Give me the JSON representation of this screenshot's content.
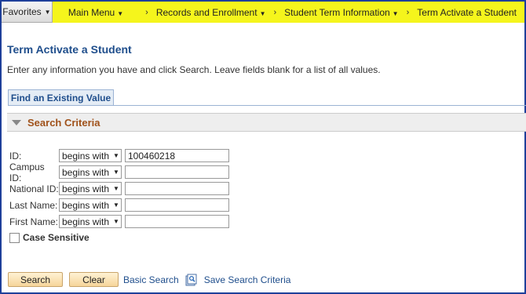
{
  "topnav": {
    "favorites": "Favorites",
    "breadcrumbs": [
      "Main Menu",
      "Records and Enrollment",
      "Student Term Information",
      "Term Activate a Student"
    ]
  },
  "page": {
    "title": "Term Activate a Student",
    "instructions": "Enter any information you have and click Search. Leave fields blank for a list of all values."
  },
  "tab": {
    "label": "Find an Existing Value"
  },
  "section": {
    "label": "Search Criteria"
  },
  "fields": [
    {
      "label": "ID:",
      "operator": "begins with",
      "value": "100460218"
    },
    {
      "label": "Campus ID:",
      "operator": "begins with",
      "value": ""
    },
    {
      "label": "National ID:",
      "operator": "begins with",
      "value": ""
    },
    {
      "label": "Last Name:",
      "operator": "begins with",
      "value": ""
    },
    {
      "label": "First Name:",
      "operator": "begins with",
      "value": ""
    }
  ],
  "case_sensitive": {
    "label": "Case Sensitive",
    "checked": false
  },
  "actions": {
    "search": "Search",
    "clear": "Clear",
    "basic_search": "Basic Search",
    "save_search": "Save Search Criteria"
  },
  "colors": {
    "breadcrumb_bg": "#f5f51c",
    "title": "#1f4e8c",
    "section_label": "#a0521b",
    "button_bg": "#f6d59a",
    "frame": "#1e3f9a"
  }
}
